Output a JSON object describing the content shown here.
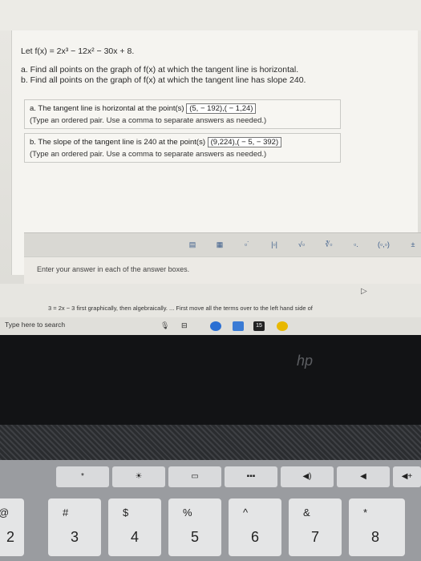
{
  "question": {
    "function": "Let f(x) = 2x³ − 12x² − 30x + 8.",
    "part_a": "a. Find all points on the graph of f(x) at which the tangent line is horizontal.",
    "part_b": "b. Find all points on the graph of f(x) at which the tangent line has slope 240."
  },
  "answers": {
    "a_prefix": "a. The tangent line is horizontal at the point(s)",
    "a_value": "(5, − 192),( − 1,24)",
    "a_hint": "(Type an ordered pair. Use a comma to separate answers as needed.)",
    "b_prefix": "b. The slope of the tangent line is 240 at the point(s)",
    "b_value": "(9,224),( − 5, − 392)",
    "b_hint": "(Type an ordered pair. Use a comma to separate answers as needed.)"
  },
  "toolbar": {
    "tools": [
      "frac",
      "mixed",
      "exp",
      "abs",
      "sqrt",
      "nroot",
      "sub",
      "paren",
      "more"
    ]
  },
  "status": {
    "text": "Enter your answer in each of the answer boxes."
  },
  "webpage": {
    "line": "3 = 2x − 3 first graphically, then algebraically. ... First move all the terms over to the left hand side of"
  },
  "taskbar": {
    "search_placeholder": "Type here to search",
    "badge": "15"
  },
  "laptop": {
    "brand": "hp"
  },
  "keyboard": {
    "fkeys": [
      "*",
      "☀",
      "▭",
      "▪▪▪",
      "◀)",
      "◀",
      "◀+",
      "▶+"
    ],
    "numrow": [
      {
        "top": "@",
        "bottom": "2"
      },
      {
        "top": "#",
        "bottom": "3"
      },
      {
        "top": "$",
        "bottom": "4"
      },
      {
        "top": "%",
        "bottom": "5"
      },
      {
        "top": "^",
        "bottom": "6"
      },
      {
        "top": "&",
        "bottom": "7"
      },
      {
        "top": "*",
        "bottom": "8"
      }
    ]
  },
  "colors": {
    "edge_blue": "#3b5c8a",
    "chrome_blue": "#2a6fd3"
  }
}
